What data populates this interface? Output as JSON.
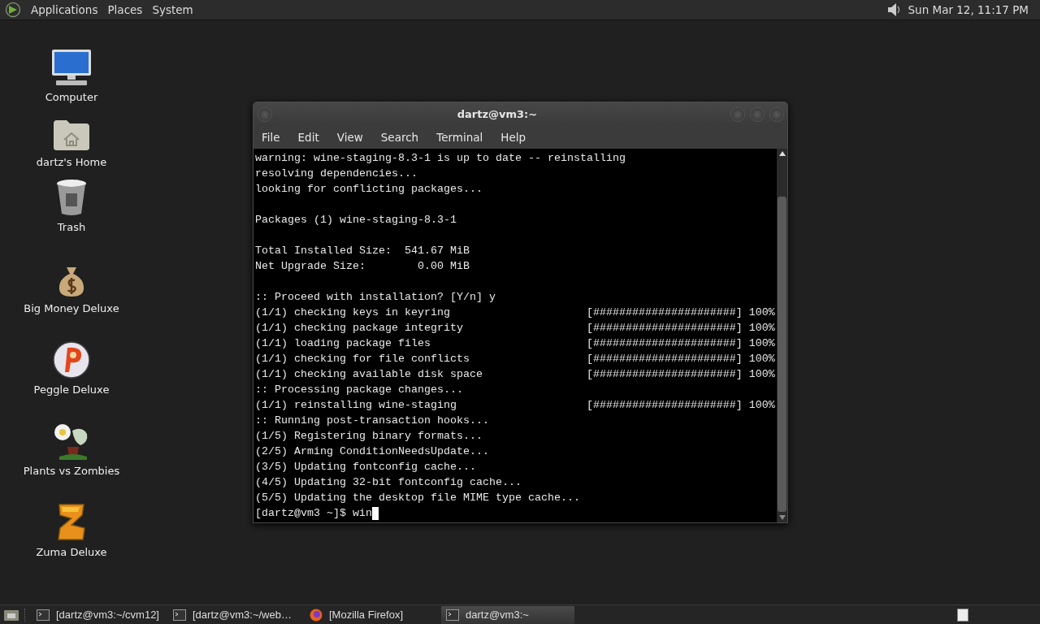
{
  "top_panel": {
    "menus": [
      "Applications",
      "Places",
      "System"
    ],
    "clock": "Sun Mar 12, 11:17 PM"
  },
  "desktop_icons": [
    {
      "kind": "computer",
      "label": "Computer"
    },
    {
      "kind": "home",
      "label": "dartz's Home"
    },
    {
      "kind": "trash",
      "label": "Trash"
    },
    {
      "kind": "money",
      "label": "Big Money Deluxe"
    },
    {
      "kind": "peggle",
      "label": "Peggle Deluxe"
    },
    {
      "kind": "plants",
      "label": "Plants vs Zombies"
    },
    {
      "kind": "zuma",
      "label": "Zuma Deluxe"
    }
  ],
  "terminal": {
    "title": "dartz@vm3:~",
    "menu": [
      "File",
      "Edit",
      "View",
      "Search",
      "Terminal",
      "Help"
    ],
    "lines": [
      {
        "kind": "text",
        "text": "warning: wine-staging-8.3-1 is up to date -- reinstalling"
      },
      {
        "kind": "text",
        "text": "resolving dependencies..."
      },
      {
        "kind": "text",
        "text": "looking for conflicting packages..."
      },
      {
        "kind": "blank"
      },
      {
        "kind": "text",
        "text": "Packages (1) wine-staging-8.3-1"
      },
      {
        "kind": "blank"
      },
      {
        "kind": "text",
        "text": "Total Installed Size:  541.67 MiB"
      },
      {
        "kind": "text",
        "text": "Net Upgrade Size:        0.00 MiB"
      },
      {
        "kind": "blank"
      },
      {
        "kind": "text",
        "text": ":: Proceed with installation? [Y/n] y"
      },
      {
        "kind": "text",
        "text": "(1/1) checking keys in keyring                     [######################] 100%"
      },
      {
        "kind": "text",
        "text": "(1/1) checking package integrity                   [######################] 100%"
      },
      {
        "kind": "text",
        "text": "(1/1) loading package files                        [######################] 100%"
      },
      {
        "kind": "text",
        "text": "(1/1) checking for file conflicts                  [######################] 100%"
      },
      {
        "kind": "text",
        "text": "(1/1) checking available disk space                [######################] 100%"
      },
      {
        "kind": "text",
        "text": ":: Processing package changes..."
      },
      {
        "kind": "text",
        "text": "(1/1) reinstalling wine-staging                    [######################] 100%"
      },
      {
        "kind": "text",
        "text": ":: Running post-transaction hooks..."
      },
      {
        "kind": "text",
        "text": "(1/5) Registering binary formats..."
      },
      {
        "kind": "text",
        "text": "(2/5) Arming ConditionNeedsUpdate..."
      },
      {
        "kind": "text",
        "text": "(3/5) Updating fontconfig cache..."
      },
      {
        "kind": "text",
        "text": "(4/5) Updating 32-bit fontconfig cache..."
      },
      {
        "kind": "text",
        "text": "(5/5) Updating the desktop file MIME type cache..."
      },
      {
        "kind": "prompt",
        "text": "[dartz@vm3 ~]$ win"
      }
    ]
  },
  "taskbar": [
    {
      "kind": "terminal",
      "label": "[dartz@vm3:~/cvm12]",
      "selected": false
    },
    {
      "kind": "terminal",
      "label": "[dartz@vm3:~/web…",
      "selected": false
    },
    {
      "kind": "firefox",
      "label": "[Mozilla Firefox]",
      "selected": false
    },
    {
      "kind": "terminal",
      "label": "dartz@vm3:~",
      "selected": true
    }
  ]
}
